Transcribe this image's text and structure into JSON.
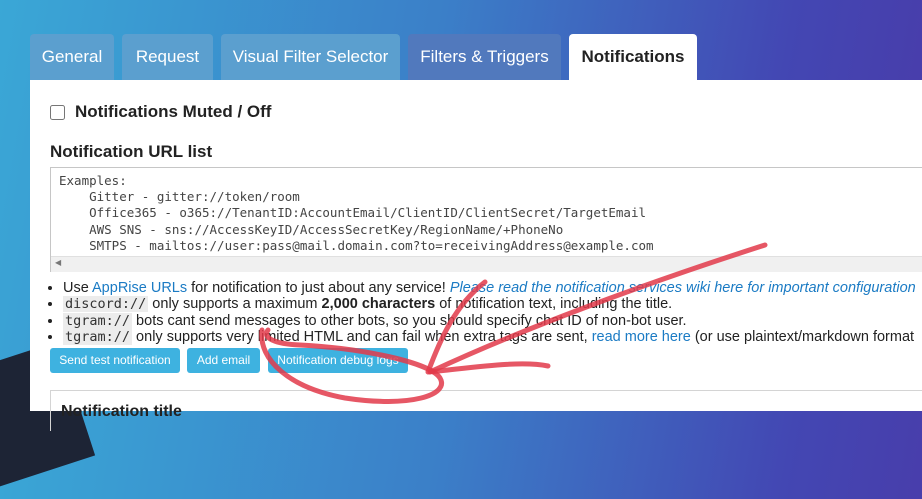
{
  "tabs": [
    {
      "label": "General",
      "active": false
    },
    {
      "label": "Request",
      "active": false
    },
    {
      "label": "Visual Filter Selector",
      "active": false
    },
    {
      "label": "Filters & Triggers",
      "active": false
    },
    {
      "label": "Notifications",
      "active": true
    }
  ],
  "mute": {
    "label": "Notifications Muted / Off",
    "checked": false
  },
  "url_list": {
    "title": "Notification URL list",
    "placeholder_lines": [
      "Examples:",
      "    Gitter - gitter://token/room",
      "    Office365 - o365://TenantID:AccountEmail/ClientID/ClientSecret/TargetEmail",
      "    AWS SNS - sns://AccessKeyID/AccessSecretKey/RegionName/+PhoneNo",
      "    SMTPS - mailtos://user:pass@mail.domain.com?to=receivingAddress@example.com"
    ]
  },
  "help": {
    "line1_prefix": "Use ",
    "line1_link": "AppRise URLs",
    "line1_middle": " for notification to just about any service! ",
    "line1_italic_link": "Please read the notification services wiki here for important configuration",
    "line2_code": "discord://",
    "line2_text_a": " only supports a maximum ",
    "line2_bold": "2,000 characters",
    "line2_text_b": " of notification text, including the title.",
    "line3_code": "tgram://",
    "line3_text": " bots cant send messages to other bots, so you should specify chat ID of non-bot user.",
    "line4_code": "tgram://",
    "line4_text": " only supports very limited HTML and can fail when extra tags are sent, ",
    "line4_link": "read more here",
    "line4_suffix": " (or use plaintext/markdown format"
  },
  "buttons": {
    "test": "Send test notification",
    "add_email": "Add email",
    "debug_logs": "Notification debug logs"
  },
  "next_section": {
    "title": "Notification title"
  },
  "colors": {
    "active_tab": "#ffffff",
    "tab": "#5b9fcf",
    "button": "#3eb2e0",
    "link": "#1b7bc4",
    "annotation": "#e23a4a"
  },
  "icons": {
    "scroll_left": "triangle-left"
  }
}
